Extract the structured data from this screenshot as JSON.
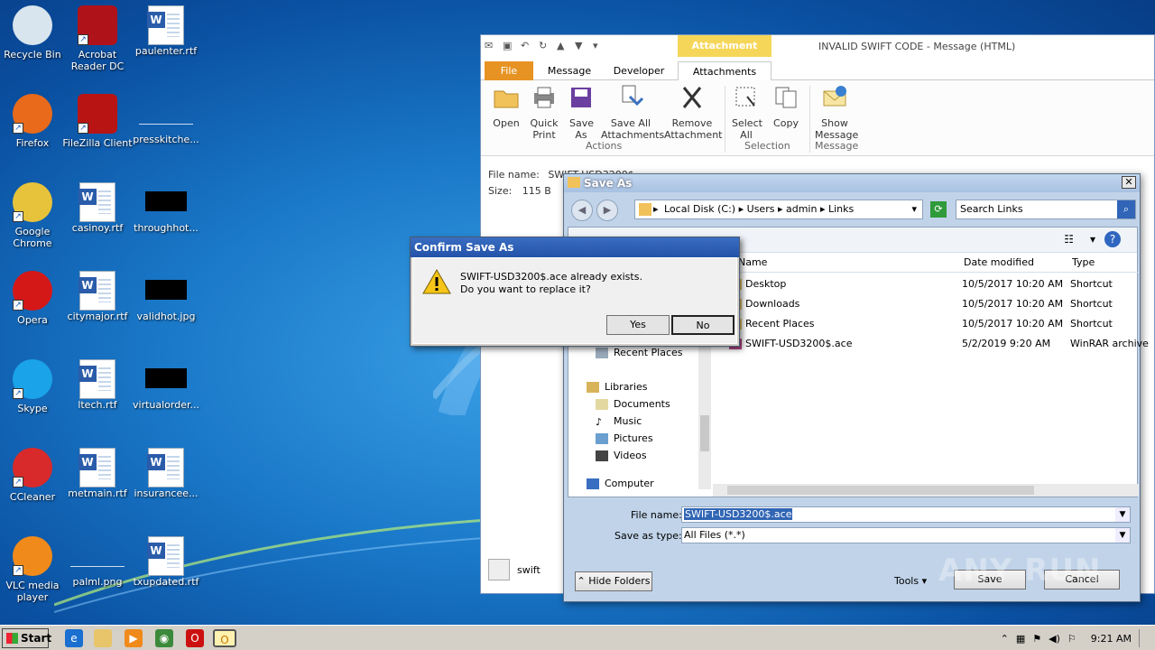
{
  "desktop": {
    "icons": [
      {
        "label": "Recycle Bin",
        "icon": "recycle-bin-icon"
      },
      {
        "label": "Acrobat Reader DC",
        "icon": "acrobat-icon"
      },
      {
        "label": "paulenter.rtf",
        "icon": "word-doc-icon"
      },
      {
        "label": "Firefox",
        "icon": "firefox-icon"
      },
      {
        "label": "FileZilla Client",
        "icon": "filezilla-icon"
      },
      {
        "label": "presskitche...",
        "icon": "blank-file-icon"
      },
      {
        "label": "Google Chrome",
        "icon": "chrome-icon"
      },
      {
        "label": "casinoy.rtf",
        "icon": "word-doc-icon"
      },
      {
        "label": "throughhot...",
        "icon": "image-icon"
      },
      {
        "label": "Opera",
        "icon": "opera-icon"
      },
      {
        "label": "citymajor.rtf",
        "icon": "word-doc-icon"
      },
      {
        "label": "validhot.jpg",
        "icon": "image-icon"
      },
      {
        "label": "Skype",
        "icon": "skype-icon"
      },
      {
        "label": "ltech.rtf",
        "icon": "word-doc-icon"
      },
      {
        "label": "virtualorder...",
        "icon": "image-icon"
      },
      {
        "label": "CCleaner",
        "icon": "ccleaner-icon"
      },
      {
        "label": "metmain.rtf",
        "icon": "word-doc-icon"
      },
      {
        "label": "insurancee...",
        "icon": "word-doc-icon"
      },
      {
        "label": "VLC media player",
        "icon": "vlc-icon"
      },
      {
        "label": "palml.png",
        "icon": "blank-file-icon"
      },
      {
        "label": "txupdated.rtf",
        "icon": "word-doc-icon"
      }
    ]
  },
  "outlook": {
    "context_tab": "Attachment Tools",
    "title": "INVALID SWIFT CODE - Message (HTML)",
    "tabs": [
      "File",
      "Message",
      "Developer",
      "Attachments"
    ],
    "ribbon": {
      "open": "Open",
      "quick_print": "Quick Print",
      "save_as": "Save As",
      "save_all": "Save All Attachments",
      "remove": "Remove Attachment",
      "select_all": "Select All",
      "copy": "Copy",
      "show_message": "Show Message",
      "group_actions": "Actions",
      "group_selection": "Selection",
      "group_message": "Message"
    },
    "file_name_label": "File name:",
    "file_name_value": "SWIFT-USD3200$",
    "size_label": "Size:",
    "size_value": "115 B",
    "sender": "swift"
  },
  "save_as": {
    "title": "Save As",
    "breadcrumb": [
      "Local Disk (C:)",
      "Users",
      "admin",
      "Links"
    ],
    "search_placeholder": "Search Links",
    "columns": {
      "name": "Name",
      "date": "Date modified",
      "type": "Type"
    },
    "files": [
      {
        "name": "Desktop",
        "date": "10/5/2017 10:20 AM",
        "type": "Shortcut"
      },
      {
        "name": "Downloads",
        "date": "10/5/2017 10:20 AM",
        "type": "Shortcut"
      },
      {
        "name": "Recent Places",
        "date": "10/5/2017 10:20 AM",
        "type": "Shortcut"
      },
      {
        "name": "SWIFT-USD3200$.ace",
        "date": "5/2/2019 9:20 AM",
        "type": "WinRAR archive"
      }
    ],
    "nav": {
      "recent_places": "Recent Places",
      "libraries": "Libraries",
      "documents": "Documents",
      "music": "Music",
      "pictures": "Pictures",
      "videos": "Videos",
      "computer": "Computer"
    },
    "file_name_label": "File name:",
    "file_name_value": "SWIFT-USD3200$.ace",
    "save_type_label": "Save as type:",
    "save_type_value": "All Files (*.*)",
    "hide_folders": "Hide Folders",
    "tools": "Tools",
    "save": "Save",
    "cancel": "Cancel"
  },
  "confirm": {
    "title": "Confirm Save As",
    "line1": "SWIFT-USD3200$.ace already exists.",
    "line2": "Do you want to replace it?",
    "yes": "Yes",
    "no": "No"
  },
  "taskbar": {
    "start": "Start",
    "time": "9:21 AM"
  },
  "watermark": "ANY RUN"
}
